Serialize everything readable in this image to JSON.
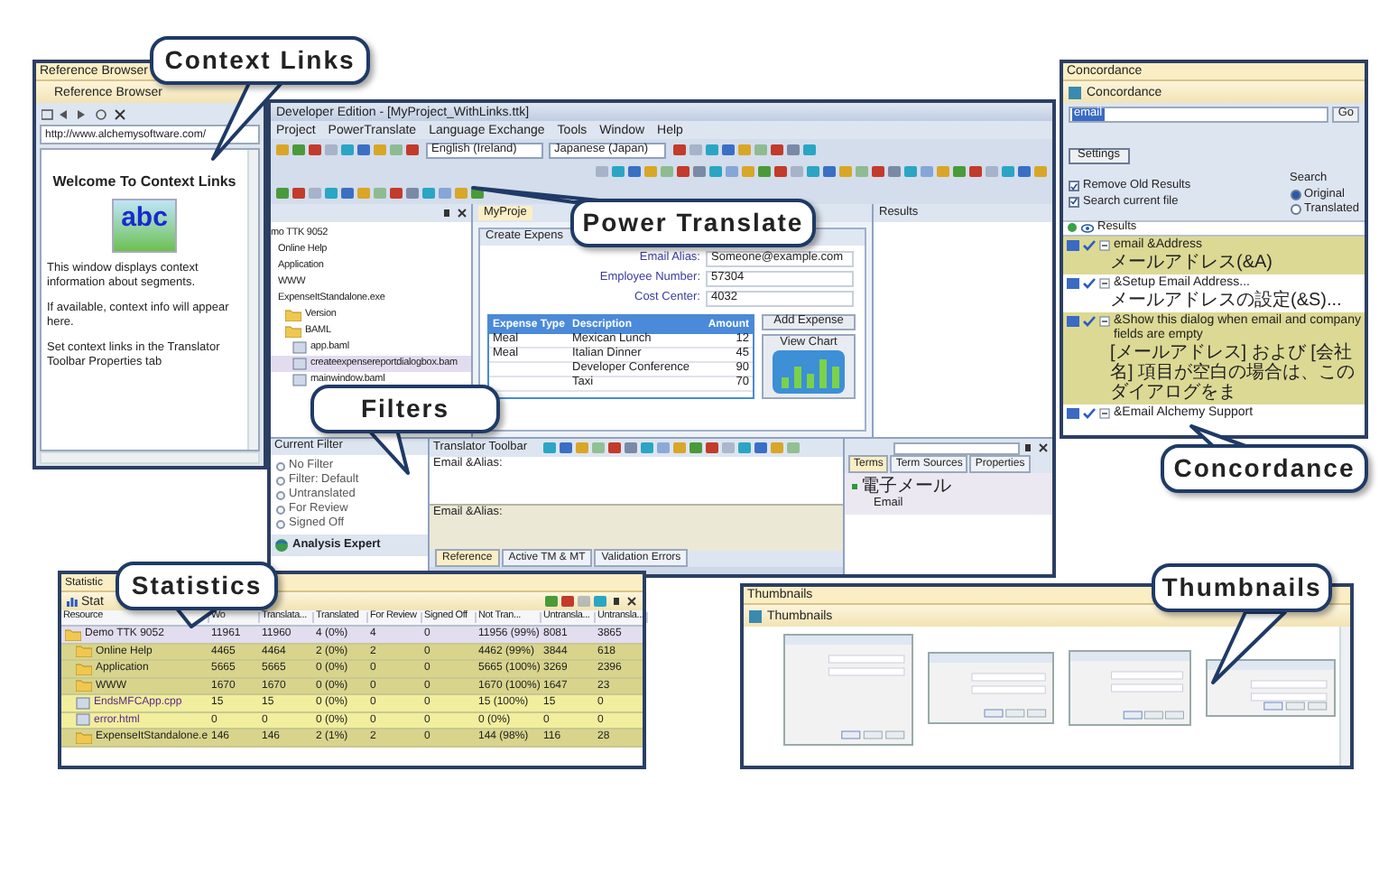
{
  "reference_browser": {
    "title": "Reference Browser",
    "header": "Reference Browser",
    "url": "http://www.alchemysoftware.com/",
    "heading": "Welcome To Context Links",
    "logo_text": "abc",
    "paragraphs": [
      "This window displays context information about segments.",
      "If available, context info will appear here.",
      "Set context links in the Translator Toolbar Properties tab"
    ]
  },
  "main_window": {
    "title": "Developer Edition - [MyProject_WithLinks.ttk]",
    "menu": [
      "Project",
      "PowerTranslate",
      "Language Exchange",
      "Tools",
      "Window",
      "Help"
    ],
    "source_language": "English (Ireland)",
    "target_language": "Japanese (Japan)",
    "project_tree": [
      {
        "label": "mo TTK 9052",
        "selected": false,
        "children": [
          {
            "label": "Online Help",
            "selected": false
          },
          {
            "label": "Application",
            "selected": false
          },
          {
            "label": "WWW",
            "selected": false
          },
          {
            "label": "ExpenseItStandalone.exe",
            "selected": false,
            "children": [
              {
                "label": "Version",
                "kind": "folder",
                "selected": false
              },
              {
                "label": "BAML",
                "kind": "folder",
                "selected": false,
                "children": [
                  {
                    "label": "app.baml",
                    "kind": "file",
                    "selected": false
                  },
                  {
                    "label": "createexpensereportdialogbox.bam",
                    "kind": "file",
                    "selected": true
                  },
                  {
                    "label": "mainwindow.baml",
                    "kind": "file",
                    "selected": false
                  }
                ]
              }
            ]
          }
        ]
      }
    ],
    "document_tab": "MyProje",
    "results_panel": "Results",
    "form": {
      "title": "Create Expens",
      "fields": [
        {
          "label": "Email Alias:",
          "value": "Someone@example.com"
        },
        {
          "label": "Employee Number:",
          "value": "57304"
        },
        {
          "label": "Cost Center:",
          "value": "4032"
        }
      ],
      "columns": [
        "Expense Type",
        "Description",
        "Amount"
      ],
      "rows": [
        [
          "Meal",
          "Mexican Lunch",
          "12"
        ],
        [
          "Meal",
          "Italian Dinner",
          "45"
        ],
        [
          "",
          "Developer Conference",
          "90"
        ],
        [
          "",
          "Taxi",
          "70"
        ]
      ],
      "add_button": "Add Expense",
      "chart_button": "View Chart"
    },
    "filter_panel": {
      "title": "Current Filter",
      "options": [
        {
          "label": "No Filter",
          "selected": false
        },
        {
          "label": "Filter: Default",
          "selected": false
        },
        {
          "label": "Untranslated",
          "selected": false
        },
        {
          "label": "For Review",
          "selected": false
        },
        {
          "label": "Signed Off",
          "selected": false
        }
      ],
      "footer": "Analysis Expert"
    },
    "translator_toolbar": {
      "title": "Translator Toolbar",
      "source": "Email &Alias:",
      "target": "Email &Alias:",
      "tabs": [
        {
          "label": "Reference",
          "selected": true
        },
        {
          "label": "Active TM & MT",
          "selected": false
        },
        {
          "label": "Validation Errors",
          "selected": false
        }
      ]
    },
    "terms_panel": {
      "tabs": [
        {
          "label": "Terms",
          "selected": true
        },
        {
          "label": "Term Sources",
          "selected": false
        },
        {
          "label": "Properties",
          "selected": false
        }
      ],
      "term": "電子メール",
      "translation": "Email"
    }
  },
  "concordance": {
    "title": "Concordance",
    "header": "Concordance",
    "search_value": "email",
    "go_button": "Go",
    "settings_button": "Settings",
    "options": [
      {
        "label": "Remove Old Results",
        "checked": true
      },
      {
        "label": "Search current file",
        "checked": true
      }
    ],
    "search_label": "Search",
    "search_modes": [
      {
        "label": "Original",
        "selected": true
      },
      {
        "label": "Translated",
        "selected": false
      }
    ],
    "results_label": "Results",
    "results": [
      {
        "source": "email &Address",
        "target": "メールアドレス(&A)",
        "highlighted": true
      },
      {
        "source": "&Setup Email Address...",
        "target": "メールアドレスの設定(&S)...",
        "highlighted": false
      },
      {
        "source": "&Show this dialog when email and company fields are empty",
        "target": "[メールアドレス] および [会社名] 項目が空白の場合は、このダイアログをま",
        "highlighted": true
      },
      {
        "source": "&Email Alchemy Support",
        "highlighted": false
      }
    ]
  },
  "statistics": {
    "title": "Statistic",
    "header": "Stat",
    "columns": [
      "Resource",
      "Wo",
      "Translata...",
      "Translated",
      "For Review",
      "Signed Off",
      "Not Tran...",
      "Untransla...",
      "Untransla..."
    ],
    "rows": [
      {
        "kind": "project",
        "cells": [
          "Demo TTK 9052",
          "11961",
          "11960",
          "4 (0%)",
          "4",
          "0",
          "11956 (99%)",
          "8081",
          "3865"
        ]
      },
      {
        "kind": "folder",
        "cells": [
          "Online Help",
          "4465",
          "4464",
          "2 (0%)",
          "2",
          "0",
          "4462 (99%)",
          "3844",
          "618"
        ]
      },
      {
        "kind": "folder",
        "cells": [
          "Application",
          "5665",
          "5665",
          "0 (0%)",
          "0",
          "0",
          "5665 (100%)",
          "3269",
          "2396"
        ]
      },
      {
        "kind": "folder",
        "cells": [
          "WWW",
          "1670",
          "1670",
          "0 (0%)",
          "0",
          "0",
          "1670 (100%)",
          "1647",
          "23"
        ]
      },
      {
        "kind": "file",
        "cells": [
          "EndsMFCApp.cpp",
          "15",
          "15",
          "0 (0%)",
          "0",
          "0",
          "15 (100%)",
          "15",
          "0"
        ]
      },
      {
        "kind": "file",
        "cells": [
          "error.html",
          "0",
          "0",
          "0 (0%)",
          "0",
          "0",
          "0 (0%)",
          "0",
          "0"
        ]
      },
      {
        "kind": "folder",
        "cells": [
          "ExpenseItStandalone.e",
          "146",
          "146",
          "2 (1%)",
          "2",
          "0",
          "144 (98%)",
          "116",
          "28"
        ]
      }
    ]
  },
  "thumbnails": {
    "title": "Thumbnails",
    "header": "Thumbnails"
  },
  "callouts": [
    "Context Links",
    "Power Translate",
    "Filters",
    "Statistics",
    "Concordance",
    "Thumbnails"
  ]
}
